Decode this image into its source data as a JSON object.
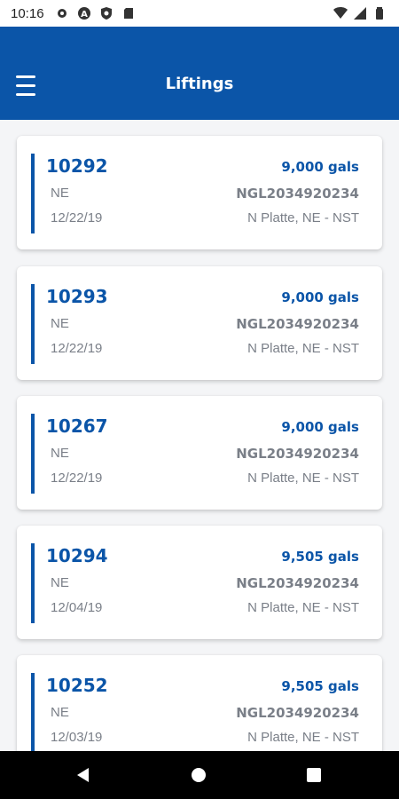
{
  "status_bar": {
    "time": "10:16"
  },
  "app_bar": {
    "title": "Liftings"
  },
  "liftings": [
    {
      "id": "10292",
      "gallons": "9,000 gals",
      "state": "NE",
      "code": "NGL2034920234",
      "date": "12/22/19",
      "location": "N Platte, NE - NST"
    },
    {
      "id": "10293",
      "gallons": "9,000 gals",
      "state": "NE",
      "code": "NGL2034920234",
      "date": "12/22/19",
      "location": "N Platte, NE - NST"
    },
    {
      "id": "10267",
      "gallons": "9,000 gals",
      "state": "NE",
      "code": "NGL2034920234",
      "date": "12/22/19",
      "location": "N Platte, NE - NST"
    },
    {
      "id": "10294",
      "gallons": "9,505 gals",
      "state": "NE",
      "code": "NGL2034920234",
      "date": "12/04/19",
      "location": "N Platte, NE - NST"
    },
    {
      "id": "10252",
      "gallons": "9,505 gals",
      "state": "NE",
      "code": "NGL2034920234",
      "date": "12/03/19",
      "location": "N Platte, NE - NST"
    }
  ],
  "colors": {
    "primary": "#0b55a8",
    "secondary_text": "#7a7f88",
    "background": "#f4f5f7"
  },
  "icons": {
    "status": [
      "settings-icon",
      "a-icon",
      "shield-icon",
      "sd-card-icon"
    ],
    "status_right": [
      "wifi-icon",
      "signal-icon",
      "battery-icon"
    ],
    "nav": [
      "back-icon",
      "home-icon",
      "recents-icon"
    ]
  }
}
